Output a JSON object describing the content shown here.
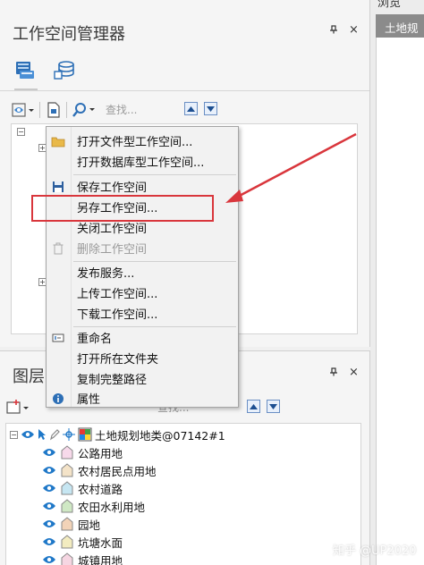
{
  "workspace_panel": {
    "title": "工作空间管理器",
    "pin_glyph": "⯐",
    "close_glyph": "×",
    "tabs": [
      {
        "icon": "file-workspace-icon"
      },
      {
        "icon": "database-workspace-icon"
      }
    ],
    "toolbar": {
      "search_placeholder": "查找..."
    }
  },
  "context_menu": {
    "items": [
      {
        "label": "打开文件型工作空间...",
        "icon": "open-folder-icon",
        "enabled": true
      },
      {
        "label": "打开数据库型工作空间...",
        "icon": "",
        "enabled": true
      },
      {
        "label": "保存工作空间",
        "icon": "save-icon",
        "enabled": true
      },
      {
        "label": "另存工作空间...",
        "icon": "",
        "enabled": true
      },
      {
        "label": "关闭工作空间",
        "icon": "",
        "enabled": true
      },
      {
        "label": "删除工作空间",
        "icon": "trash-icon",
        "enabled": false
      },
      {
        "label": "发布服务...",
        "icon": "",
        "enabled": true
      },
      {
        "label": "上传工作空间...",
        "icon": "",
        "enabled": true
      },
      {
        "label": "下载工作空间...",
        "icon": "",
        "enabled": true
      },
      {
        "label": "重命名",
        "icon": "rename-icon",
        "enabled": true
      },
      {
        "label": "打开所在文件夹",
        "icon": "",
        "enabled": true
      },
      {
        "label": "复制完整路径",
        "icon": "",
        "enabled": true
      },
      {
        "label": "属性",
        "icon": "info-icon",
        "enabled": true
      }
    ]
  },
  "layer_panel": {
    "title": "图层",
    "search_placeholder": "查找...",
    "root_label": "土地规划地类@07142#1",
    "layers": [
      {
        "label": "公路用地",
        "color": "#f7d9ea"
      },
      {
        "label": "农村居民点用地",
        "color": "#f4e3c8"
      },
      {
        "label": "农村道路",
        "color": "#c6e6f2"
      },
      {
        "label": "农田水利用地",
        "color": "#cfe8c4"
      },
      {
        "label": "园地",
        "color": "#f2d3b8"
      },
      {
        "label": "坑塘水面",
        "color": "#f3ecc0"
      },
      {
        "label": "城镇用地",
        "color": "#f6d6e2"
      }
    ]
  },
  "right_panel": {
    "top_tab": "浏览",
    "header": "土地规"
  },
  "watermark": "知乎 @UP2020",
  "colors": {
    "annotation_red": "#d9363c",
    "eye_blue": "#1f78c8"
  }
}
